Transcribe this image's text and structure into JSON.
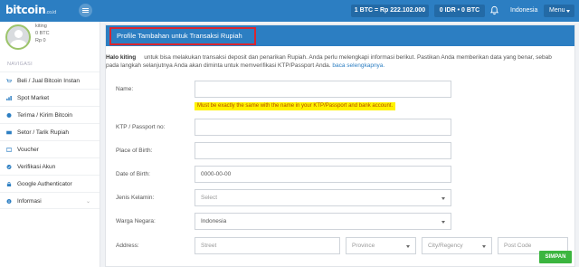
{
  "brand": {
    "name": "bitcoin",
    "suffix": ".co.id"
  },
  "topbar": {
    "price": "1 BTC = Rp 222.102.000",
    "balance": "0 IDR • 0 BTC",
    "language": "Indonesia",
    "menu_label": "Menu"
  },
  "user": {
    "name": "kiting",
    "btc": "0 BTC",
    "idr": "Rp 0"
  },
  "sidebar": {
    "heading": "NAVIGASI",
    "items": [
      {
        "label": "Beli / Jual Bitcoin Instan",
        "icon": "cart-icon"
      },
      {
        "label": "Spot Market",
        "icon": "chart-icon"
      },
      {
        "label": "Terima / Kirim Bitcoin",
        "icon": "bitcoin-icon"
      },
      {
        "label": "Setor / Tarik Rupiah",
        "icon": "money-icon"
      },
      {
        "label": "Voucher",
        "icon": "voucher-icon"
      },
      {
        "label": "Verifikasi Akun",
        "icon": "check-icon"
      },
      {
        "label": "Google Authenticator",
        "icon": "lock-icon"
      },
      {
        "label": "Informasi",
        "icon": "info-icon"
      }
    ]
  },
  "panel": {
    "title": "Profile Tambahan untuk Transaksi Rupiah",
    "intro_greeting": "Halo kiting",
    "intro_line1": "untuk bisa melakukan transaksi deposit dan penarikan Rupiah. Anda perlu melengkapi informasi berikut. Pastikan Anda memberikan data yang benar, sebab",
    "intro_line2": "pada langkah selanjutnya Anda akan diminta untuk memverifikasi KTP/Passport Anda.",
    "intro_link": "baca selengkapnya."
  },
  "form": {
    "name_label": "Name:",
    "name_value": "",
    "name_warning": "Must be exactly the same with the name in your KTP/Passport and bank account.",
    "ktp_label": "KTP / Passport no:",
    "ktp_value": "",
    "birthplace_label": "Place of Birth:",
    "birthplace_value": "",
    "dob_label": "Date of Birth:",
    "dob_value": "0000-00-00",
    "gender_label": "Jenis Kelamin:",
    "gender_value": "Select",
    "citizenship_label": "Warga Negara:",
    "citizenship_value": "Indonesia",
    "address_label": "Address:",
    "street_placeholder": "Street",
    "province_placeholder": "Province",
    "city_placeholder": "City/Regency",
    "postcode_placeholder": "Post Code",
    "save_label": "SIMPAN"
  },
  "colors": {
    "primary": "#2c7ec2",
    "highlight_border": "#d9262f",
    "warning_bg": "#fff200",
    "save": "#3bb53f"
  }
}
